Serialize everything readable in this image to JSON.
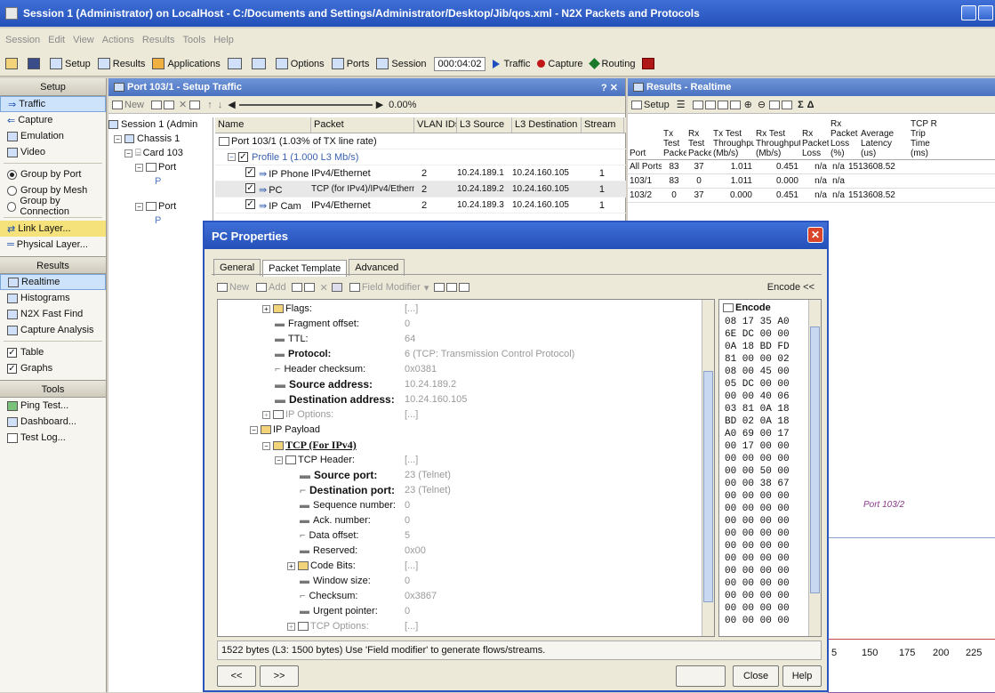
{
  "window": {
    "title": "Session 1 (Administrator) on LocalHost - C:/Documents and Settings/Administrator/Desktop/Jib/qos.xml - N2X Packets and Protocols"
  },
  "menu": [
    "Session",
    "Edit",
    "View",
    "Actions",
    "Results",
    "Tools",
    "Help"
  ],
  "toolbar": {
    "setup": "Setup",
    "results": "Results",
    "applications": "Applications",
    "options": "Options",
    "ports": "Ports",
    "session": "Session",
    "timer": "000:04:02",
    "traffic": "Traffic",
    "capture": "Capture",
    "routing": "Routing"
  },
  "sidebar": {
    "setup_header": "Setup",
    "setup_items": [
      "Traffic",
      "Capture",
      "Emulation",
      "Video"
    ],
    "group_options": [
      "Group by Port",
      "Group by Mesh",
      "Group by Connection"
    ],
    "layers": [
      "Link Layer...",
      "Physical Layer..."
    ],
    "results_header": "Results",
    "results_items": [
      "Realtime",
      "Histograms",
      "N2X Fast Find",
      "Capture Analysis"
    ],
    "checks": [
      "Table",
      "Graphs"
    ],
    "tools_header": "Tools",
    "tools_items": [
      "Ping Test...",
      "Dashboard...",
      "Test Log..."
    ]
  },
  "setup_panel": {
    "title": "Port 103/1 - Setup Traffic",
    "new": "New",
    "percent": "0.00%",
    "tree": [
      "Session 1 (Admin",
      "Chassis 1",
      "Card 103",
      "Port",
      "P",
      "Port",
      "P"
    ],
    "columns": [
      "Name",
      "Packet",
      "VLAN IDs",
      "L3 Source",
      "L3 Destination",
      "Stream"
    ],
    "port_row": "Port 103/1 (1.03% of TX line rate)",
    "profile_row": "Profile 1 (1.000 L3 Mb/s)",
    "streams": [
      {
        "name": "IP Phone",
        "packet": "IPv4/Ethernet",
        "vlan": "2",
        "src": "10.24.189.1",
        "dst": "10.24.160.105",
        "count": "1"
      },
      {
        "name": "PC",
        "packet": "TCP (for IPv4)/IPv4/Ethernet",
        "vlan": "2",
        "src": "10.24.189.2",
        "dst": "10.24.160.105",
        "count": "1"
      },
      {
        "name": "IP Cam",
        "packet": "IPv4/Ethernet",
        "vlan": "2",
        "src": "10.24.189.3",
        "dst": "10.24.160.105",
        "count": "1"
      }
    ]
  },
  "results_panel": {
    "title": "Results - Realtime",
    "setup": "Setup",
    "columns": [
      "Port",
      "Tx Test Packets",
      "Rx Test Packets",
      "Tx Test Throughput (Mb/s)",
      "Rx Test Throughput (Mb/s)",
      "Rx Packet Loss",
      "Rx Packet Loss (%)",
      "Average Latency (us)",
      "TCP R Trip Time (ms)"
    ],
    "rows": [
      [
        "All Ports",
        "83",
        "37",
        "1.011",
        "0.451",
        "n/a",
        "n/a",
        "1513608.52"
      ],
      [
        "103/1",
        "83",
        "0",
        "1.011",
        "0.000",
        "n/a",
        "n/a",
        ""
      ],
      [
        "103/2",
        "0",
        "37",
        "0.000",
        "0.451",
        "n/a",
        "n/a",
        "1513608.52"
      ]
    ],
    "legend": "Port 103/2",
    "axis_ticks": [
      "5",
      "150",
      "175",
      "200",
      "225"
    ]
  },
  "dialog": {
    "title": "PC Properties",
    "tabs": [
      "General",
      "Packet Template",
      "Advanced"
    ],
    "toolbar": {
      "new": "New",
      "add": "Add",
      "field_modifier": "Field Modifier",
      "encode": "Encode <<"
    },
    "fields": [
      {
        "name": "Flags:",
        "value": "[...]"
      },
      {
        "name": "Fragment offset:",
        "value": "0"
      },
      {
        "name": "TTL:",
        "value": "64"
      },
      {
        "name": "Protocol:",
        "value": "6 (TCP: Transmission Control Protocol)"
      },
      {
        "name": "Header checksum:",
        "value": "0x0381"
      },
      {
        "name": "Source address:",
        "value": "10.24.189.2"
      },
      {
        "name": "Destination address:",
        "value": "10.24.160.105"
      },
      {
        "name": "IP Options:",
        "value": "[...]"
      },
      {
        "name": "IP Payload",
        "value": ""
      },
      {
        "name": "TCP (For IPv4)",
        "value": ""
      },
      {
        "name": "TCP Header:",
        "value": "[...]"
      },
      {
        "name": "Source port:",
        "value": "23 (Telnet)"
      },
      {
        "name": "Destination port:",
        "value": "23 (Telnet)"
      },
      {
        "name": "Sequence number:",
        "value": "0"
      },
      {
        "name": "Ack. number:",
        "value": "0"
      },
      {
        "name": "Data offset:",
        "value": "5"
      },
      {
        "name": "Reserved:",
        "value": "0x00"
      },
      {
        "name": "Code Bits:",
        "value": "[...]"
      },
      {
        "name": "Window size:",
        "value": "0"
      },
      {
        "name": "Checksum:",
        "value": "0x3867"
      },
      {
        "name": "Urgent pointer:",
        "value": "0"
      },
      {
        "name": "TCP Options:",
        "value": "[...]"
      }
    ],
    "encode_header": "Encode",
    "encode_lines": [
      "08 17 35 A0",
      "6E DC 00 00",
      "0A 18 BD FD",
      "81 00 00 02",
      "08 00 45 00",
      "05 DC 00 00",
      "00 00 40 06",
      "03 81 0A 18",
      "BD 02 0A 18",
      "A0 69 00 17",
      "00 17 00 00",
      "00 00 00 00",
      "00 00 50 00",
      "00 00 38 67",
      "00 00 00 00",
      "00 00 00 00",
      "00 00 00 00",
      "00 00 00 00",
      "00 00 00 00",
      "00 00 00 00",
      "00 00 00 00",
      "00 00 00 00",
      "00 00 00 00",
      "00 00 00 00",
      "00 00 00 00"
    ],
    "status": "1522 bytes (L3: 1500 bytes) Use 'Field modifier' to generate flows/streams.",
    "prev": "<<",
    "next": ">>",
    "close": "Close",
    "help": "Help"
  }
}
